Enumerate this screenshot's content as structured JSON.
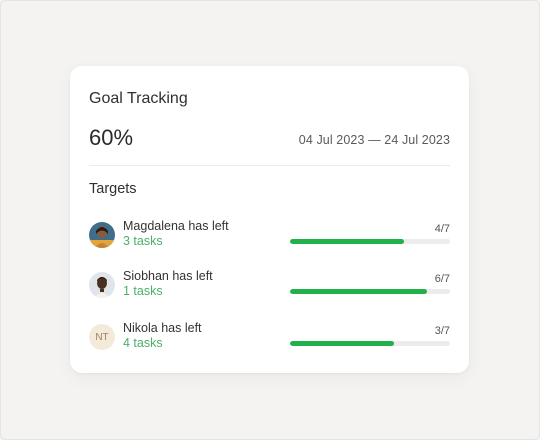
{
  "card": {
    "title": "Goal Tracking",
    "percent": "60%",
    "date_range": "04 Jul 2023 — 24 Jul 2023"
  },
  "targets": {
    "title": "Targets",
    "items": [
      {
        "name": "Magdalena has left",
        "tasks": "3 tasks",
        "ratio": "4/7",
        "progress": 0.714,
        "avatar": "photo"
      },
      {
        "name": "Siobhan has left",
        "tasks": "1 tasks",
        "ratio": "6/7",
        "progress": 0.857,
        "avatar": "photo"
      },
      {
        "name": "Nikola has left",
        "tasks": "4 tasks",
        "ratio": "3/7",
        "progress": 0.65,
        "avatar": "NT"
      }
    ]
  },
  "colors": {
    "accent_green": "#22b04a",
    "tasks_green": "#4caf6a"
  }
}
